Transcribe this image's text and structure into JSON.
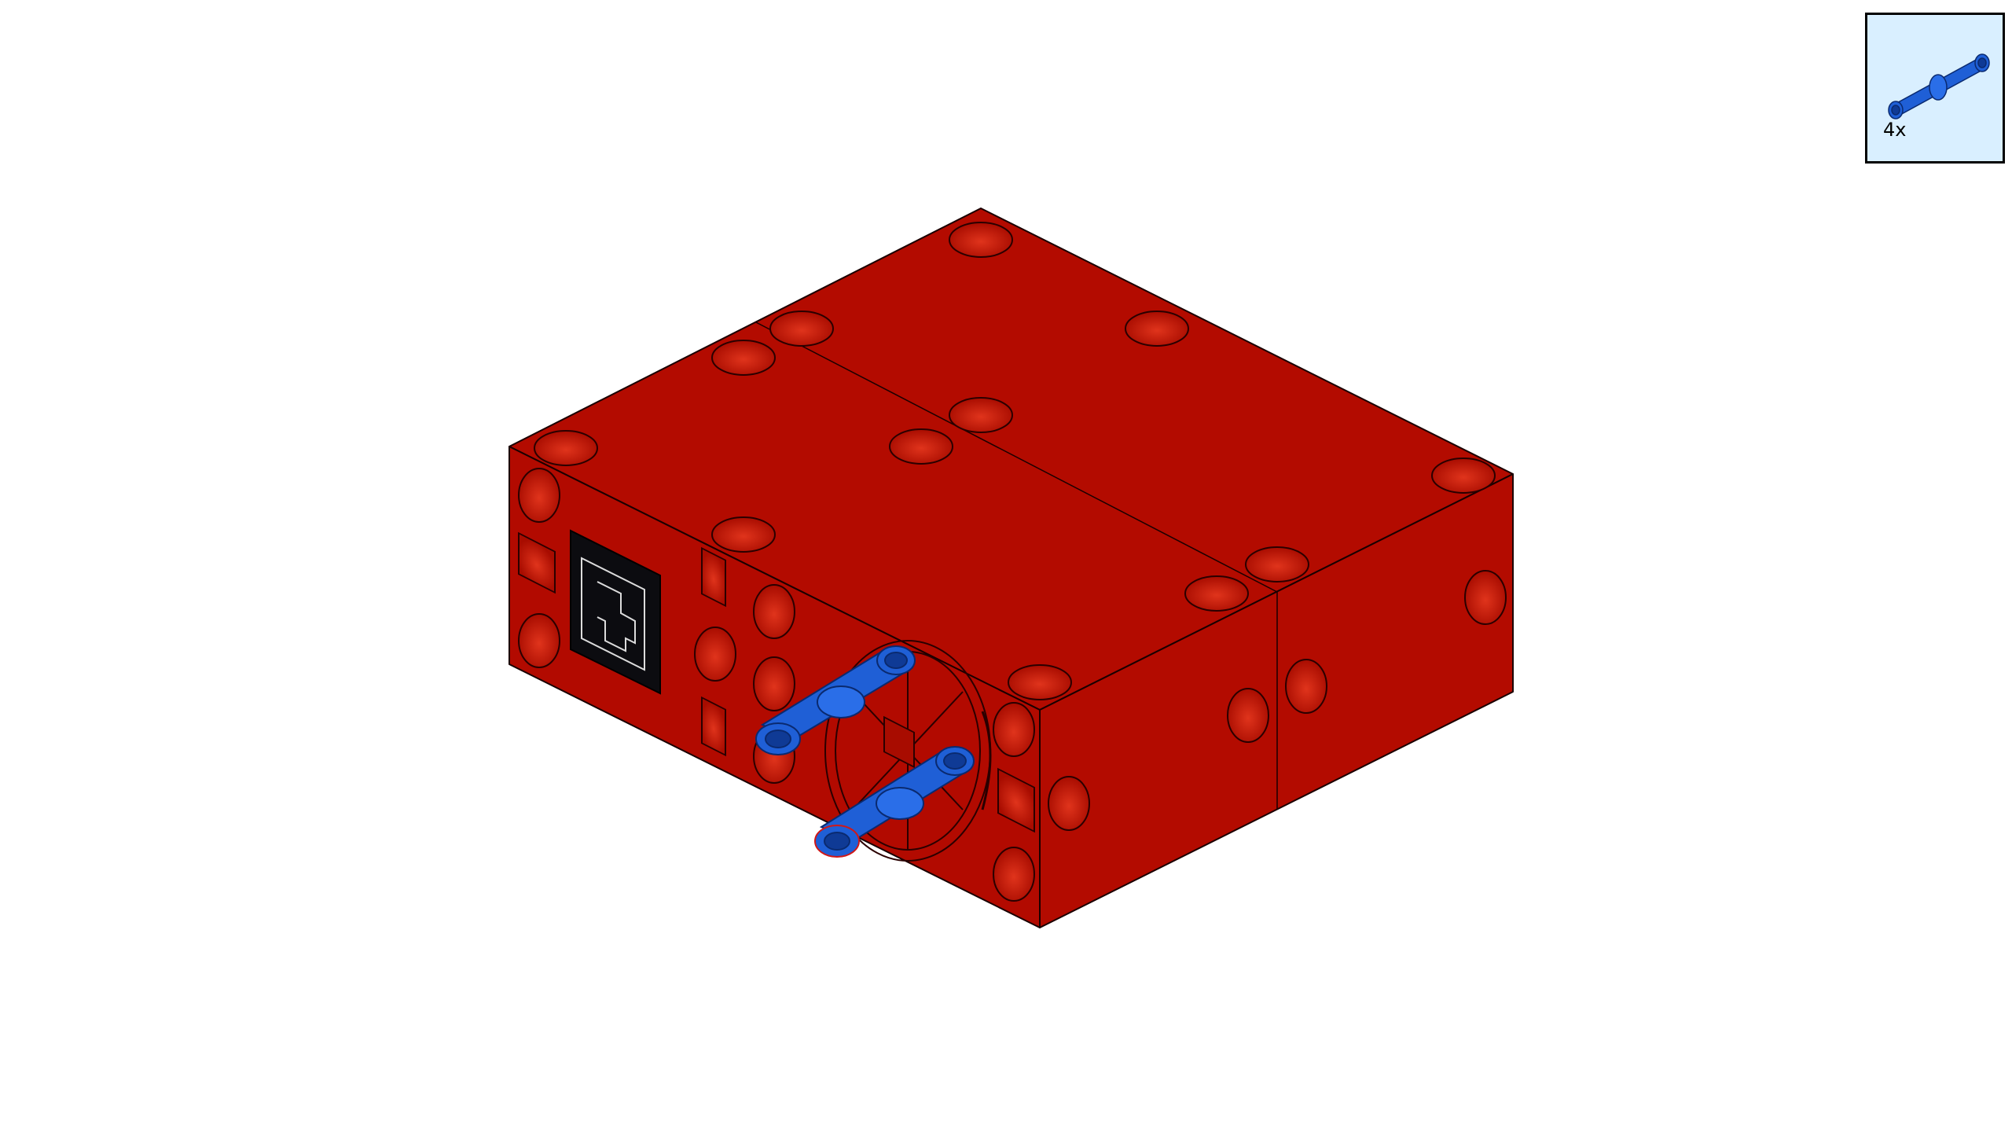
{
  "instruction_step": {
    "parts_list": [
      {
        "part": "pin-icon",
        "quantity_label": "4x",
        "color": "#1f5fd6"
      }
    ],
    "model": {
      "brick_color": "#b30b00",
      "pin_color": "#1f5fd6",
      "connector_color": "#0c0c10"
    }
  }
}
